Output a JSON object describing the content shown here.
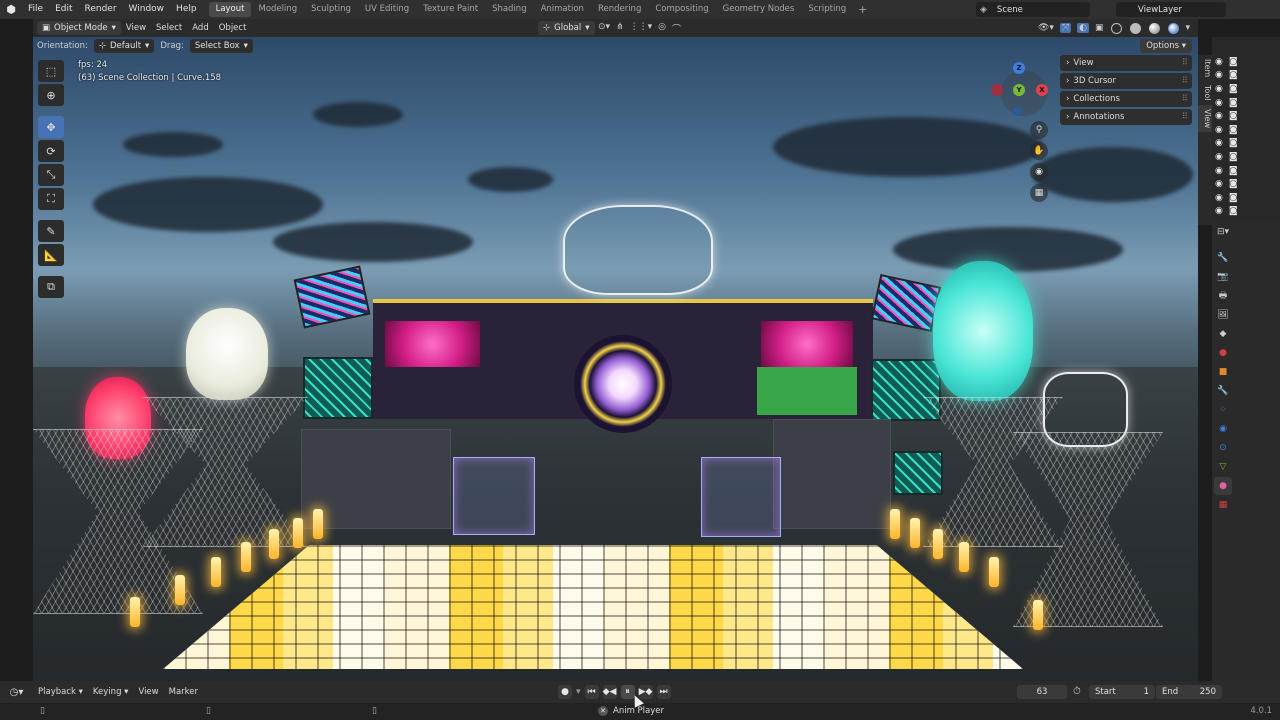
{
  "topbar": {
    "menus": [
      "File",
      "Edit",
      "Render",
      "Window",
      "Help"
    ],
    "workspaces": [
      "Layout",
      "Modeling",
      "Sculpting",
      "UV Editing",
      "Texture Paint",
      "Shading",
      "Animation",
      "Rendering",
      "Compositing",
      "Geometry Nodes",
      "Scripting"
    ],
    "active_workspace": "Layout",
    "add_tab": "+",
    "scene": "Scene",
    "view_layer": "ViewLayer"
  },
  "header": {
    "mode": "Object Mode",
    "menus": [
      "View",
      "Select",
      "Add",
      "Object"
    ],
    "transform_orientation": "Global"
  },
  "tool_settings": {
    "orientation_label": "Orientation:",
    "orientation_value": "Default",
    "drag_label": "Drag:",
    "drag_value": "Select Box",
    "options": "Options"
  },
  "viewport": {
    "fps": "fps: 24",
    "collection": "(63) Scene Collection | Curve.158"
  },
  "gizmo": {
    "z": "Z",
    "y": "Y",
    "x": "X"
  },
  "npanel": {
    "rows": [
      "View",
      "3D Cursor",
      "Collections",
      "Annotations"
    ],
    "tabs": [
      "Item",
      "Tool",
      "View"
    ]
  },
  "timeline": {
    "menus": [
      "Playback",
      "Keying",
      "View",
      "Marker"
    ],
    "current_frame": "63",
    "start_label": "Start",
    "start": "1",
    "end_label": "End",
    "end": "250"
  },
  "statusbar": {
    "center_label": "Anim Player",
    "version": "4.0.1"
  },
  "colors": {
    "accent_active": "#4772b3",
    "axis_x": "#e0404f",
    "axis_y": "#7bb83a",
    "axis_z": "#3d7fe0"
  },
  "icons": {
    "logo": "blender-logo-icon",
    "eye": "eye-icon",
    "camera": "camera-icon",
    "cursor": "mouse-cursor-icon"
  }
}
